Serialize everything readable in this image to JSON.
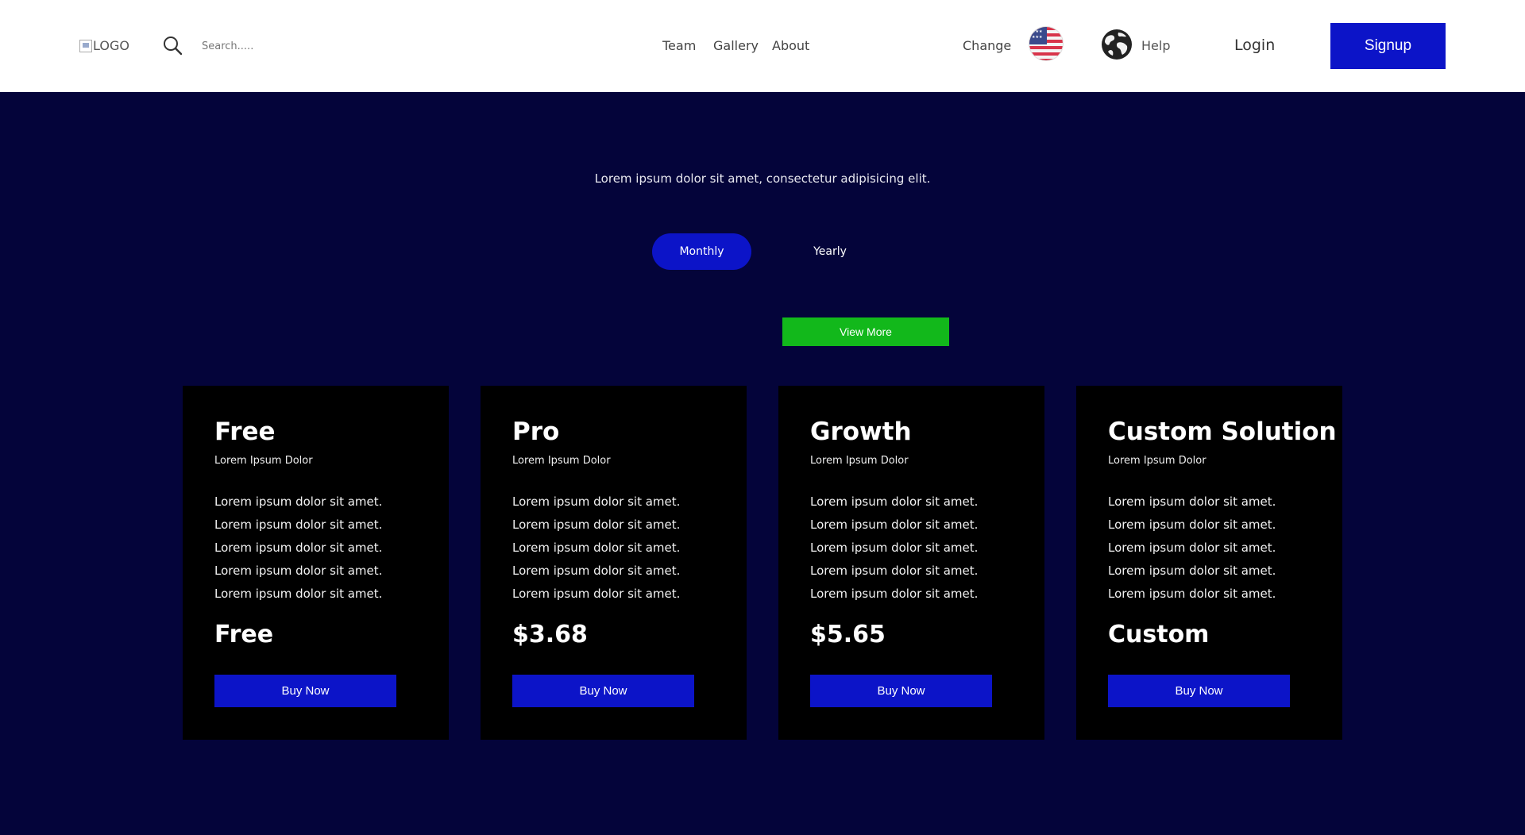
{
  "header": {
    "logo_alt": "LOGO",
    "search_placeholder": "Search.....",
    "nav": [
      "Team",
      "Gallery",
      "About"
    ],
    "change_label": "Change",
    "help_label": "Help",
    "login_label": "Login",
    "signup_label": "Signup"
  },
  "hero": {
    "subtitle": "Lorem ipsum dolor sit amet, consectetur adipisicing elit.",
    "toggle": {
      "monthly": "Monthly",
      "yearly": "Yearly",
      "selected": "Monthly"
    },
    "view_more": "View More"
  },
  "plans": [
    {
      "name": "Free",
      "subtitle": "Lorem Ipsum Dolor",
      "features": [
        "Lorem ipsum dolor sit amet.",
        "Lorem ipsum dolor sit amet.",
        "Lorem ipsum dolor sit amet.",
        "Lorem ipsum dolor sit amet.",
        "Lorem ipsum dolor sit amet."
      ],
      "price": "Free",
      "cta": "Buy Now"
    },
    {
      "name": "Pro",
      "subtitle": "Lorem Ipsum Dolor",
      "features": [
        "Lorem ipsum dolor sit amet.",
        "Lorem ipsum dolor sit amet.",
        "Lorem ipsum dolor sit amet.",
        "Lorem ipsum dolor sit amet.",
        "Lorem ipsum dolor sit amet."
      ],
      "price": "$3.68",
      "cta": "Buy Now"
    },
    {
      "name": "Growth",
      "subtitle": "Lorem Ipsum Dolor",
      "features": [
        "Lorem ipsum dolor sit amet.",
        "Lorem ipsum dolor sit amet.",
        "Lorem ipsum dolor sit amet.",
        "Lorem ipsum dolor sit amet.",
        "Lorem ipsum dolor sit amet."
      ],
      "price": "$5.65",
      "cta": "Buy Now"
    },
    {
      "name": "Custom Solution",
      "subtitle": "Lorem Ipsum Dolor",
      "features": [
        "Lorem ipsum dolor sit amet.",
        "Lorem ipsum dolor sit amet.",
        "Lorem ipsum dolor sit amet.",
        "Lorem ipsum dolor sit amet.",
        "Lorem ipsum dolor sit amet."
      ],
      "price": "Custom",
      "cta": "Buy Now"
    }
  ],
  "colors": {
    "page_bg": "#04043a",
    "header_bg": "#ffffff",
    "accent_blue": "#0c14c8",
    "view_more_green": "#12b81b",
    "card_bg": "#000000"
  },
  "icons": [
    "search-icon",
    "us-flag-icon",
    "globe-icon"
  ]
}
